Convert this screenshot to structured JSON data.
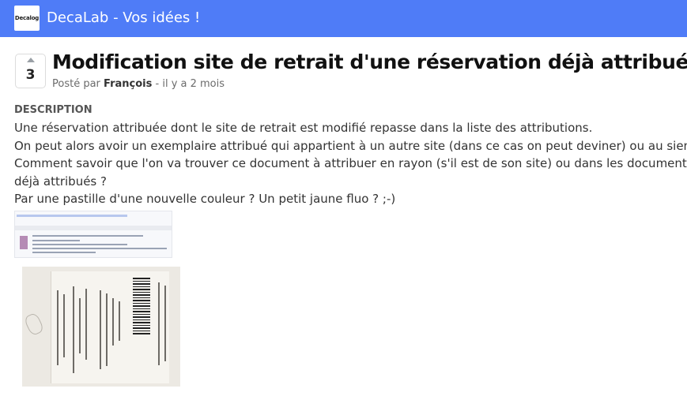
{
  "app": {
    "logo_text": "Decalog",
    "title": "DecaLab - Vos idées !",
    "accent": "#4f7cf7"
  },
  "post": {
    "votes": "3",
    "title": "Modification site de retrait d'une réservation déjà attribuée",
    "posted_by_prefix": "Posté par",
    "author": "François",
    "time": "- il y a 2 mois",
    "description_label": "DESCRIPTION",
    "description_lines": [
      "Une réservation attribuée dont le site de retrait est modifié repasse dans la liste des attributions.",
      "On peut alors avoir un exemplaire attribué qui appartient à un autre site (dans ce cas on peut deviner) ou au sien.",
      "Comment savoir que l'on va trouver ce document à attribuer en rayon (s'il est de son site) ou dans les documents",
      "déjà attribués ?",
      "Par une pastille d'une nouvelle couleur ? Un petit jaune fluo ? ;-)"
    ]
  },
  "attachments": [
    {
      "kind": "screenshot-thumbnail"
    },
    {
      "kind": "photo-thumbnail"
    }
  ]
}
